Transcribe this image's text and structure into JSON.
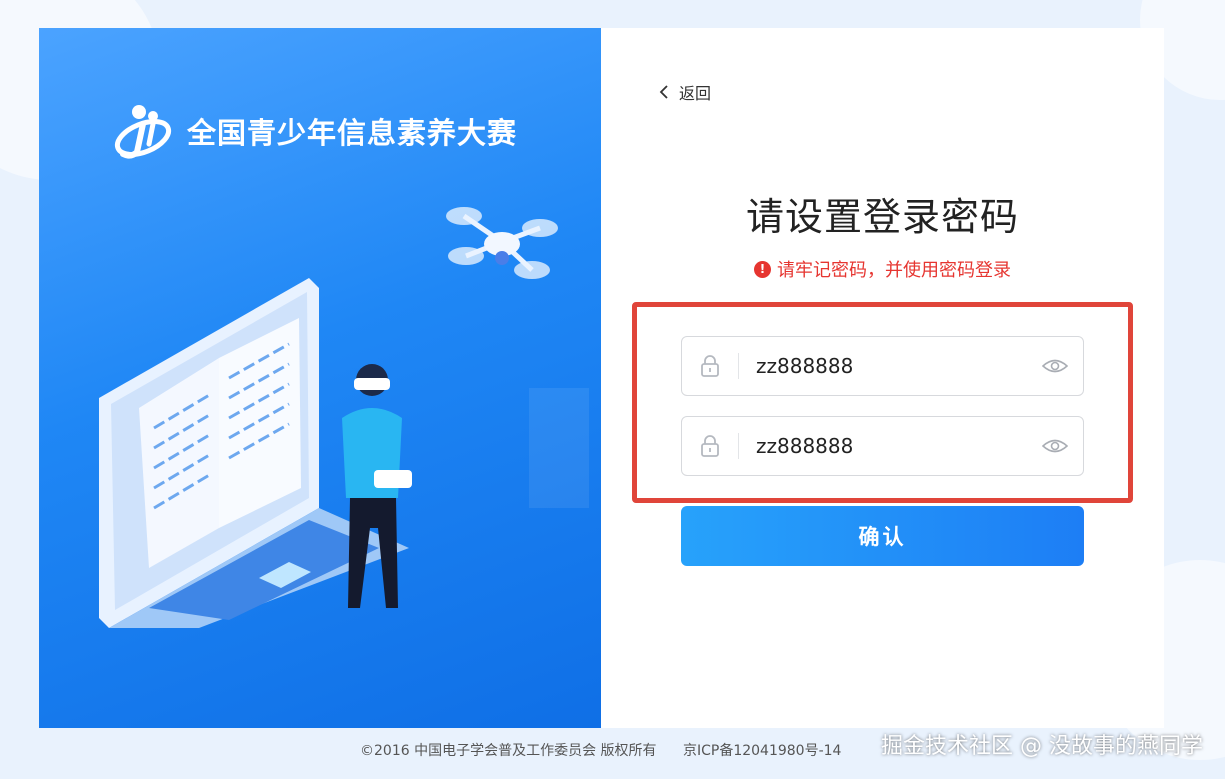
{
  "logo": {
    "title": "全国青少年信息素养大赛"
  },
  "nav": {
    "back_label": "返回"
  },
  "form": {
    "title": "请设置登录密码",
    "warning": "请牢记密码，并使用密码登录",
    "password_value": "zz888888",
    "confirm_value": "zz888888",
    "submit_label": "确认"
  },
  "footer": {
    "copyright": "©2016 中国电子学会普及工作委员会 版权所有",
    "icp": "京ICP备12041980号-14"
  },
  "watermark": "掘金技术社区 @ 没故事的燕同学",
  "colors": {
    "accent": "#1d7ef5",
    "warning": "#e63530",
    "highlight": "#e0453a"
  }
}
